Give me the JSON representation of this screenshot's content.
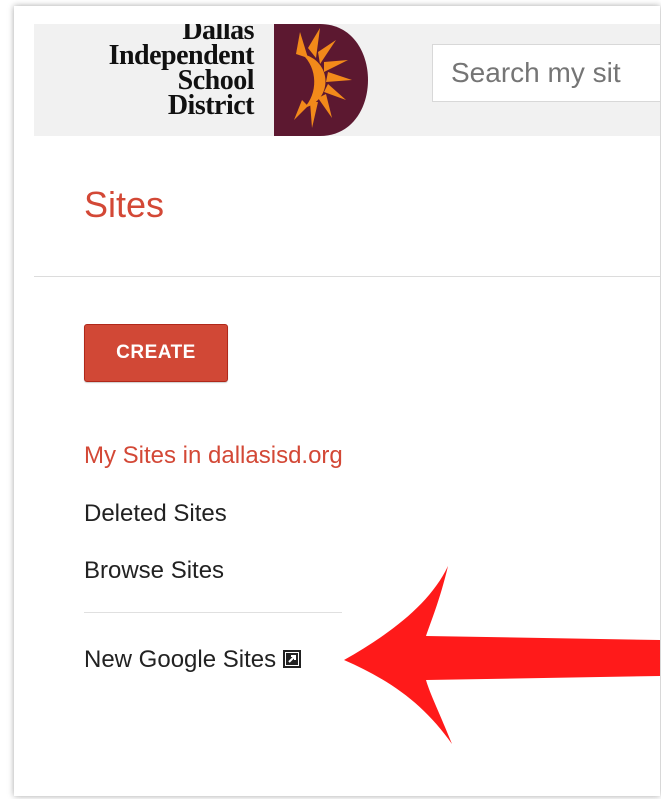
{
  "header": {
    "logo_lines": [
      "Dallas",
      "Independent",
      "School",
      "District"
    ],
    "search_placeholder": "Search my sit"
  },
  "page": {
    "title": "Sites"
  },
  "create_button": {
    "label": "CREATE"
  },
  "nav": {
    "items": [
      {
        "label": "My Sites in dallasisd.org",
        "active": true
      },
      {
        "label": "Deleted Sites",
        "active": false
      },
      {
        "label": "Browse Sites",
        "active": false
      },
      {
        "label": "New Google Sites",
        "active": false
      }
    ]
  },
  "colors": {
    "accent": "#d34836",
    "logo_maroon": "#5c1830",
    "logo_orange": "#f28a1a",
    "arrow": "#ff1a1a"
  },
  "icons": {
    "new_sites_link": "external-link-icon"
  }
}
